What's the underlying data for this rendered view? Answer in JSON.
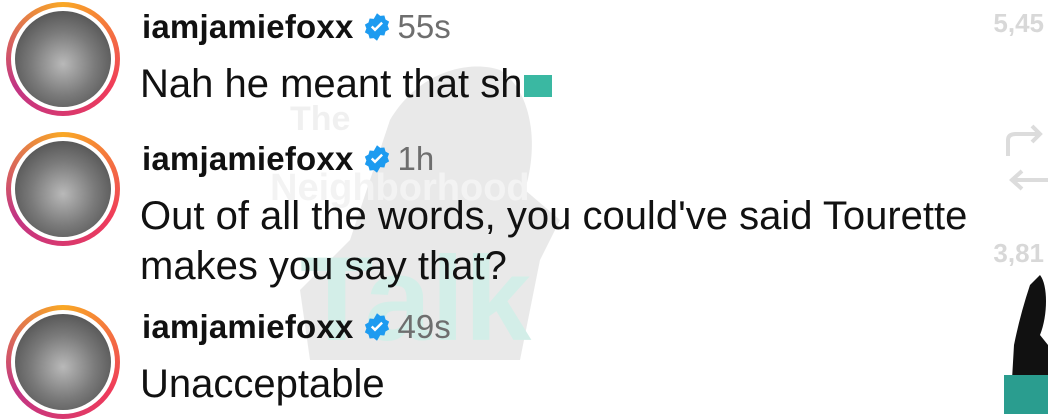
{
  "comments": [
    {
      "username": "iamjamiefoxx",
      "time": "55s",
      "text": "Nah he meant that sh"
    },
    {
      "username": "iamjamiefoxx",
      "time": "1h",
      "line1": "Out of all the words, you could've said Tourette",
      "line2": "makes you say that?"
    },
    {
      "username": "iamjamiefoxx",
      "time": "49s",
      "text": "Unacceptable"
    }
  ],
  "watermark": {
    "line1": "The",
    "line2": "Neighborhood",
    "line3": "Talk"
  },
  "sidebar": {
    "count1": "5,45",
    "count2": "3,81"
  },
  "icons": [
    "verified-badge-icon",
    "share-icon",
    "reply-icon"
  ],
  "colors": {
    "verified": "#1d9bf0",
    "watermark": "#9fd9cc",
    "censor": "#3ab8a2"
  }
}
